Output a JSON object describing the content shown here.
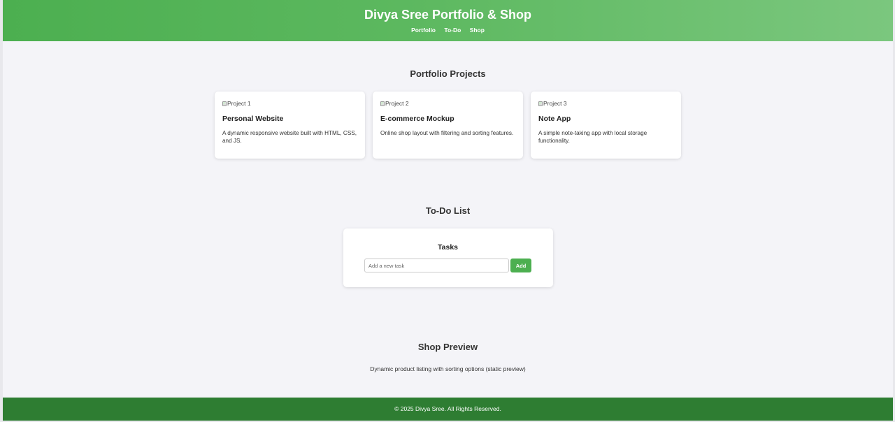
{
  "header": {
    "title": "Divya Sree Portfolio & Shop",
    "nav": [
      "Portfolio",
      "To-Do",
      "Shop"
    ]
  },
  "portfolio": {
    "heading": "Portfolio Projects",
    "projects": [
      {
        "image_alt": "Project 1",
        "title": "Personal Website",
        "description": "A dynamic responsive website built with HTML, CSS, and JS."
      },
      {
        "image_alt": "Project 2",
        "title": "E-commerce Mockup",
        "description": "Online shop layout with filtering and sorting features."
      },
      {
        "image_alt": "Project 3",
        "title": "Note App",
        "description": "A simple note-taking app with local storage functionality."
      }
    ]
  },
  "todo": {
    "heading": "To-Do List",
    "box_title": "Tasks",
    "input_placeholder": "Add a new task",
    "input_value": "",
    "add_label": "Add"
  },
  "shop": {
    "heading": "Shop Preview",
    "description": "Dynamic product listing with sorting options (static preview)"
  },
  "footer": {
    "text": "© 2025 Divya Sree. All Rights Reserved."
  },
  "colors": {
    "header_gradient_start": "#4caf50",
    "header_gradient_end": "#7bc77e",
    "accent": "#4caf50",
    "footer": "#2e7d32",
    "background": "#f4f4f8"
  },
  "icons": {
    "broken_image": "broken-image-icon"
  }
}
